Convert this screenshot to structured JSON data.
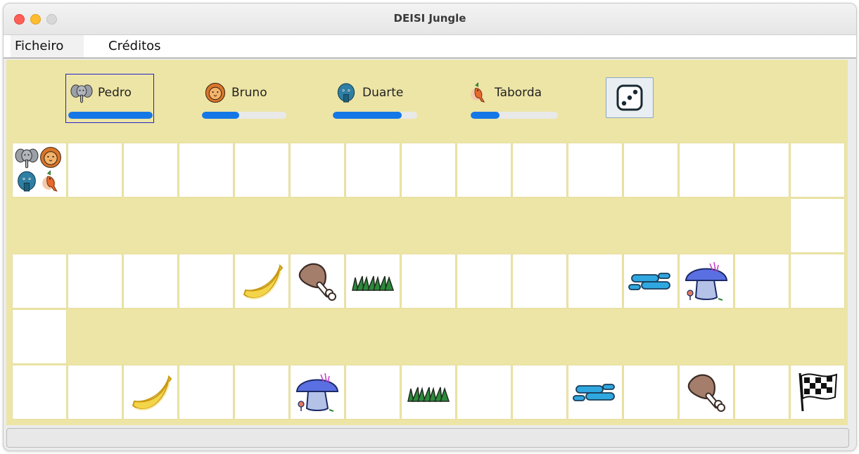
{
  "window": {
    "title": "DEISI Jungle"
  },
  "menu": {
    "items": [
      "Ficheiro",
      "Créditos"
    ]
  },
  "players": [
    {
      "name": "Pedro",
      "icon": "elephant-icon",
      "energy": 1.0,
      "selected": true
    },
    {
      "name": "Bruno",
      "icon": "lion-icon",
      "energy": 0.44
    },
    {
      "name": "Duarte",
      "icon": "tapir-icon",
      "energy": 0.82
    },
    {
      "name": "Taborda",
      "icon": "bird-icon",
      "energy": 0.33
    }
  ],
  "dice": {
    "icon": "dice-three-icon"
  },
  "board": {
    "rows": [
      {
        "cells": 15,
        "items": {
          "0": "players-stack"
        }
      },
      {
        "cells": 1,
        "align": "right"
      },
      {
        "cells": 15,
        "items": {
          "4": "banana-icon",
          "5": "meat-icon",
          "6": "grass-icon",
          "11": "water-icon",
          "12": "mushroom-icon"
        }
      },
      {
        "cells": 1,
        "align": "left"
      },
      {
        "cells": 15,
        "items": {
          "2": "banana-icon",
          "5": "mushroom-icon",
          "7": "grass-icon",
          "10": "water-icon",
          "12": "meat-icon",
          "14": "finish-flag-icon"
        }
      }
    ]
  }
}
